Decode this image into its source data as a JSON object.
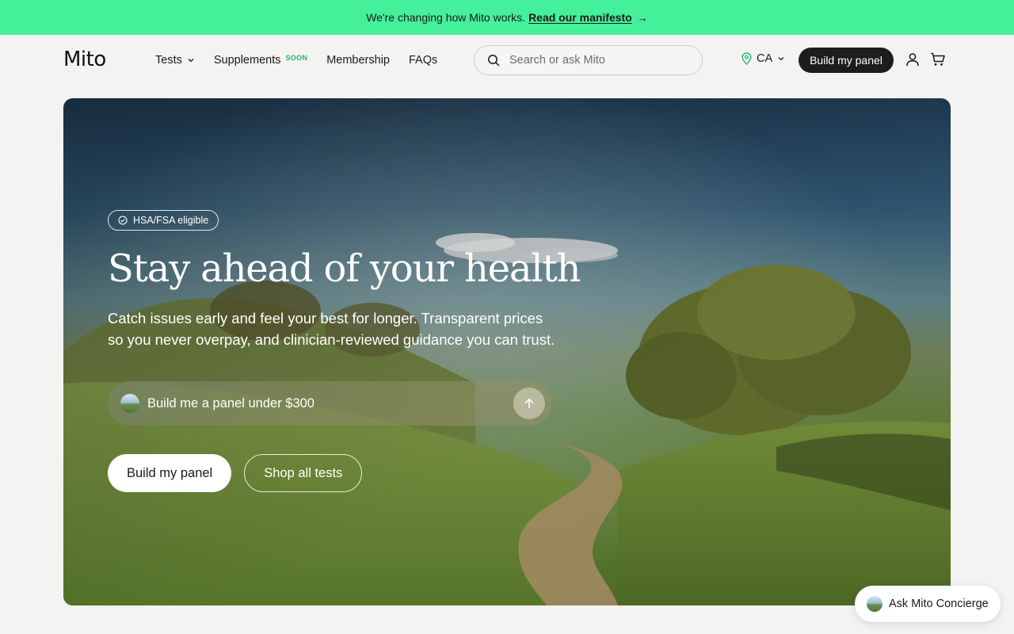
{
  "announcement": {
    "text": "We're changing how Mito works.",
    "link_label": "Read our manifesto",
    "link_arrow": "→"
  },
  "header": {
    "logo": "Mito",
    "nav": [
      {
        "label": "Tests",
        "has_dropdown": true
      },
      {
        "label": "Supplements",
        "badge": "SOON"
      },
      {
        "label": "Membership"
      },
      {
        "label": "FAQs"
      }
    ],
    "search": {
      "placeholder": "Search or ask Mito",
      "value": ""
    },
    "region": "CA",
    "cta": "Build my panel",
    "icons": [
      "search-icon",
      "location-pin-icon",
      "chevron-down-icon",
      "user-icon",
      "cart-icon"
    ]
  },
  "hero": {
    "badge": "HSA/FSA eligible",
    "title": "Stay ahead of your health",
    "subtitle_line1": "Catch issues early and feel your best for longer. Transparent prices",
    "subtitle_line2": "so you never overpay, and clinician-reviewed guidance you can trust.",
    "prompt": "Build me a panel under $300",
    "primary_button": "Build my panel",
    "secondary_button": "Shop all tests"
  },
  "concierge": {
    "label": "Ask Mito Concierge"
  },
  "colors": {
    "announcement_bg": "#45f09b",
    "page_bg": "#f4f3f1",
    "dark_button": "#1d1d1b",
    "accent_green": "#1fb86a"
  }
}
